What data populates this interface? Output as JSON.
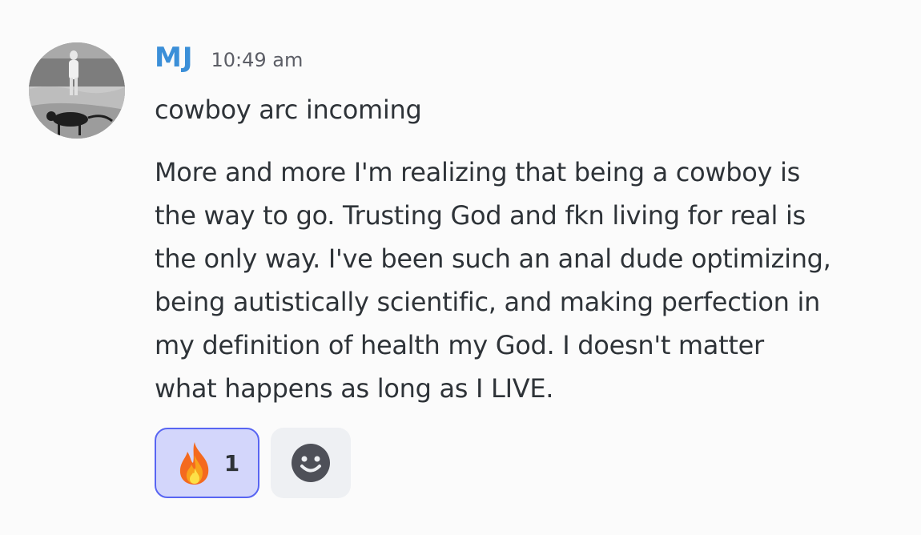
{
  "message": {
    "author": "MJ",
    "timestamp": "10:49 am",
    "title_line": "cowboy arc incoming",
    "body_lines": [
      "More and more I'm realizing that being a cowboy is",
      "the way to go. Trusting God and fkn living for real is",
      "the only way. I've been such an anal dude optimizing,",
      "being autistically scientific, and making perfection in",
      "my definition of health my God. I doesn't matter",
      "what happens as long as I LIVE."
    ]
  },
  "reactions": [
    {
      "emoji": "fire-icon",
      "count": "1"
    }
  ],
  "add_reaction": {
    "icon": "smiley-add-reaction-icon"
  },
  "colors": {
    "author": "#3b8fd8",
    "reaction_bg": "#d3d6fb",
    "reaction_border": "#5865f2",
    "add_reaction_bg": "#eef0f3"
  }
}
